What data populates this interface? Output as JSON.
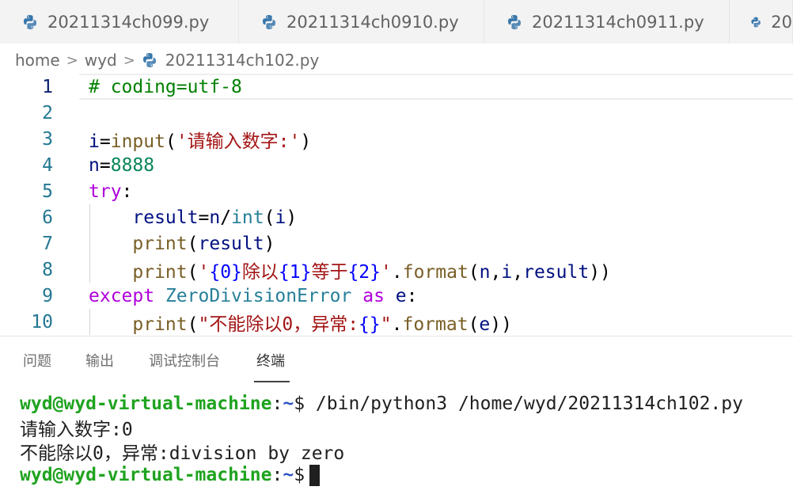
{
  "tabs": [
    {
      "label": "20211314ch099.py"
    },
    {
      "label": "20211314ch0910.py"
    },
    {
      "label": "20211314ch0911.py"
    },
    {
      "label": "20"
    }
  ],
  "breadcrumb": {
    "items": [
      "home",
      "wyd"
    ],
    "file": "20211314ch102.py"
  },
  "editor": {
    "line_numbers": [
      "1",
      "2",
      "3",
      "4",
      "5",
      "6",
      "7",
      "8",
      "9",
      "10"
    ],
    "lines": {
      "l1": [
        "# coding=utf-8"
      ],
      "l3": [
        "i",
        "=",
        "input",
        "(",
        "'请输入数字:'",
        ")"
      ],
      "l4": [
        "n",
        "=",
        "8888"
      ],
      "l5": [
        "try",
        ":"
      ],
      "l6": [
        "    ",
        "result",
        "=",
        "n",
        "/",
        "int",
        "(",
        "i",
        ")"
      ],
      "l7": [
        "    ",
        "print",
        "(",
        "result",
        ")"
      ],
      "l8": [
        "    ",
        "print",
        "(",
        "'",
        "{0}",
        "除以",
        "{1}",
        "等于",
        "{2}",
        "'",
        ".",
        "format",
        "(",
        "n",
        ",",
        "i",
        ",",
        "result",
        "))"
      ],
      "l9": [
        "except",
        " ",
        "ZeroDivisionError",
        " ",
        "as",
        " ",
        "e",
        ":"
      ],
      "l10": [
        "    ",
        "print",
        "(",
        "\"不能除以0，异常:",
        "{}",
        "\"",
        ".",
        "format",
        "(",
        "e",
        "))"
      ]
    }
  },
  "panel": {
    "tabs": [
      "问题",
      "输出",
      "调试控制台",
      "终端"
    ],
    "active_tab": "终端"
  },
  "terminal": {
    "user": "wyd@wyd-virtual-machine",
    "colon": ":",
    "path": "~",
    "dollar": "$",
    "command": " /bin/python3 /home/wyd/20211314ch102.py",
    "output1": "请输入数字:0",
    "output2": "不能除以0，异常:division by zero"
  },
  "icons": {
    "file": "python-icon",
    "separator": "chevron-right-icon"
  },
  "colors": {
    "accent_line": "#0b216f",
    "terminal_user": "#1fa31f",
    "terminal_path": "#2d52c4"
  }
}
